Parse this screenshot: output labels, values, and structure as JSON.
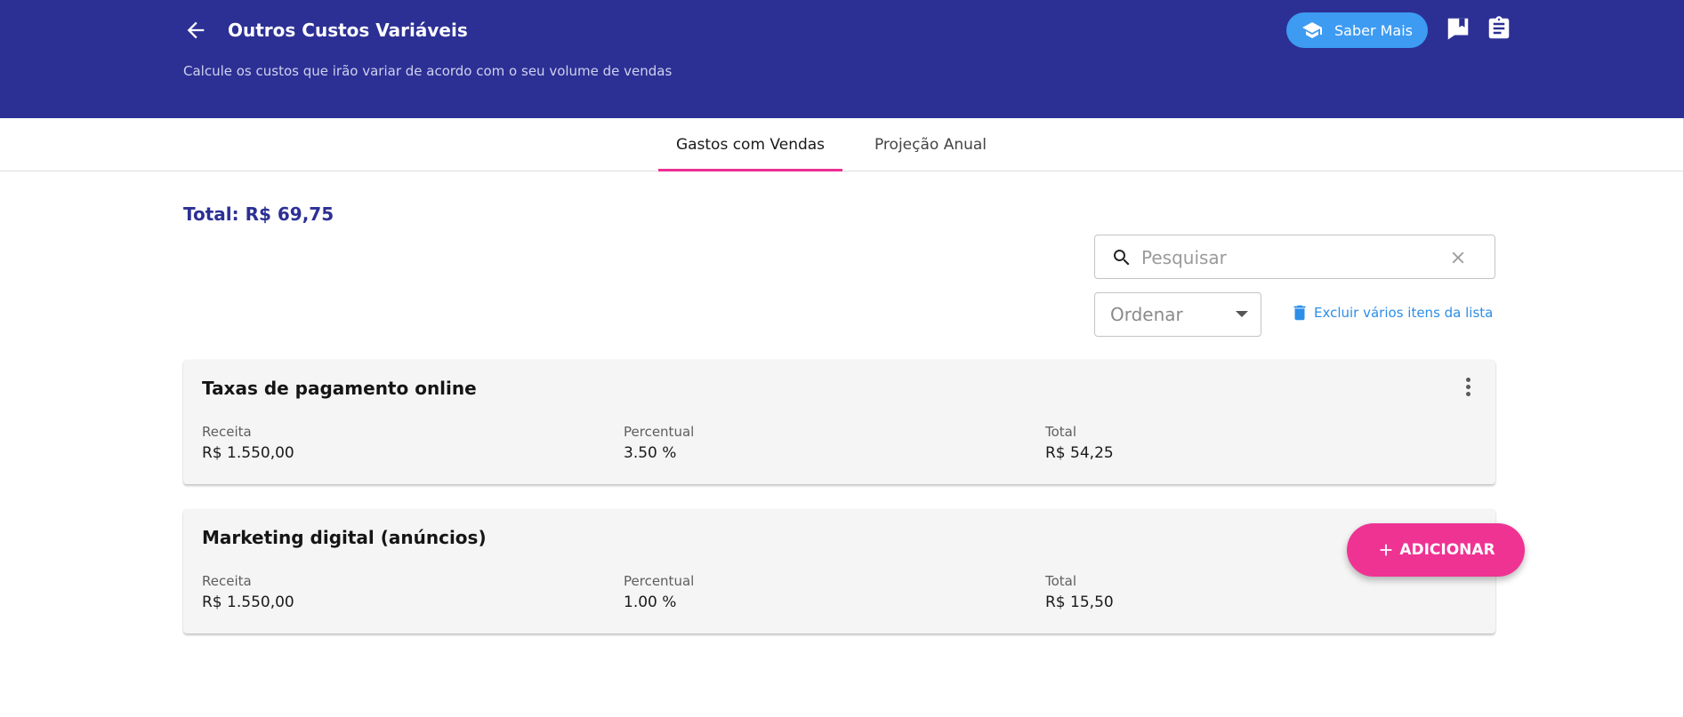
{
  "header": {
    "title": "Outros Custos Variáveis",
    "subtitle": "Calcule os custos que irão variar de acordo com o seu volume de vendas",
    "learn_more_label": "Saber Mais",
    "background_color": "#2c3094",
    "learn_more_color": "#3d9bf2",
    "icons": [
      "arrow-left-icon",
      "graduation-cap-icon",
      "bookmark-book-icon",
      "clipboard-icon"
    ]
  },
  "tabs": [
    {
      "label": "Gastos com Vendas",
      "active": true
    },
    {
      "label": "Projeção Anual",
      "active": false
    }
  ],
  "tab_indicator_color": "#ee2e93",
  "summary": {
    "total_label": "Total: R$ 69,75"
  },
  "search": {
    "placeholder": "Pesquisar",
    "value": ""
  },
  "order": {
    "label": "Ordenar"
  },
  "bulk_delete": {
    "label": "Excluir vários itens da lista"
  },
  "items": [
    {
      "title": "Taxas de pagamento online",
      "receita_label": "Receita",
      "receita": "R$ 1.550,00",
      "percentual_label": "Percentual",
      "percentual": "3.50 %",
      "total_label": "Total",
      "total": "R$ 54,25"
    },
    {
      "title": "Marketing digital (anúncios)",
      "receita_label": "Receita",
      "receita": "R$ 1.550,00",
      "percentual_label": "Percentual",
      "percentual": "1.00 %",
      "total_label": "Total",
      "total": "R$ 15,50"
    }
  ],
  "fab": {
    "label": "ADICIONAR",
    "color": "#ef3393"
  }
}
